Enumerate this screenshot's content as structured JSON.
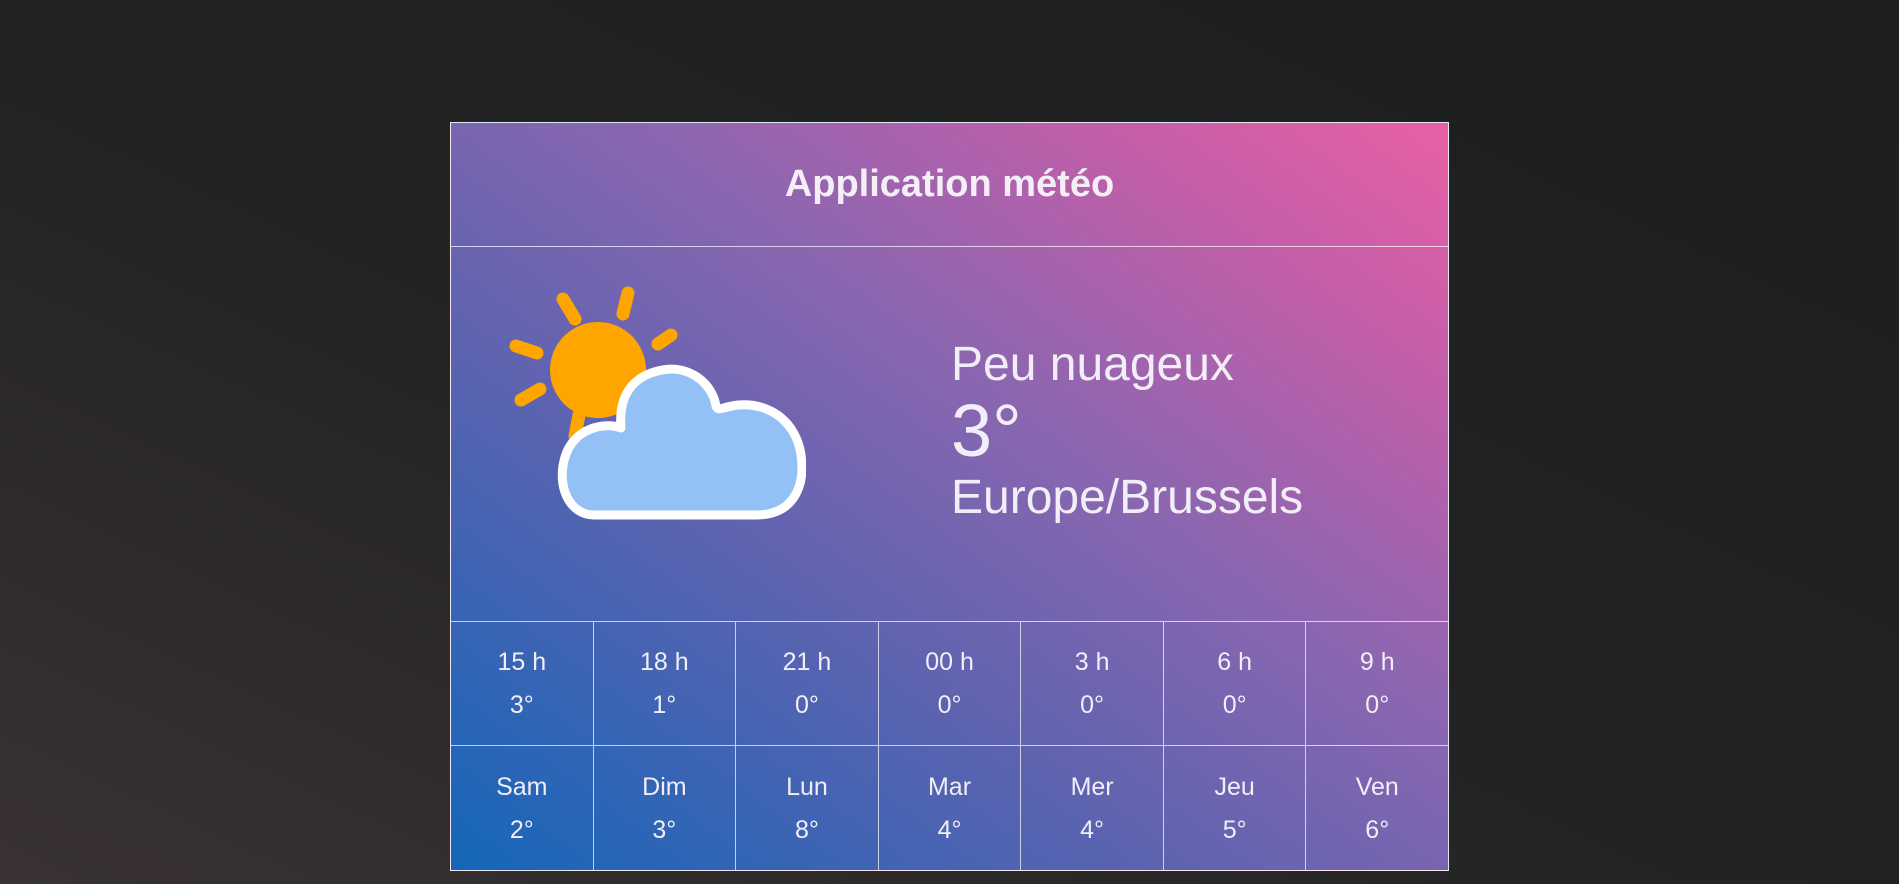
{
  "app": {
    "title": "Application météo"
  },
  "current": {
    "icon": "partly-cloudy-icon",
    "description": "Peu nuageux",
    "temperature": "3°",
    "timezone": "Europe/Brussels"
  },
  "hourly": [
    {
      "time": "15 h",
      "temp": "3°"
    },
    {
      "time": "18 h",
      "temp": "1°"
    },
    {
      "time": "21 h",
      "temp": "0°"
    },
    {
      "time": "00 h",
      "temp": "0°"
    },
    {
      "time": "3 h",
      "temp": "0°"
    },
    {
      "time": "6 h",
      "temp": "0°"
    },
    {
      "time": "9 h",
      "temp": "0°"
    }
  ],
  "daily": [
    {
      "day": "Sam",
      "temp": "2°"
    },
    {
      "day": "Dim",
      "temp": "3°"
    },
    {
      "day": "Lun",
      "temp": "8°"
    },
    {
      "day": "Mar",
      "temp": "4°"
    },
    {
      "day": "Mer",
      "temp": "4°"
    },
    {
      "day": "Jeu",
      "temp": "5°"
    },
    {
      "day": "Ven",
      "temp": "6°"
    }
  ],
  "colors": {
    "sun": "#ffa500",
    "cloud": "#93c0f5",
    "cloud_outline": "#ffffff"
  }
}
